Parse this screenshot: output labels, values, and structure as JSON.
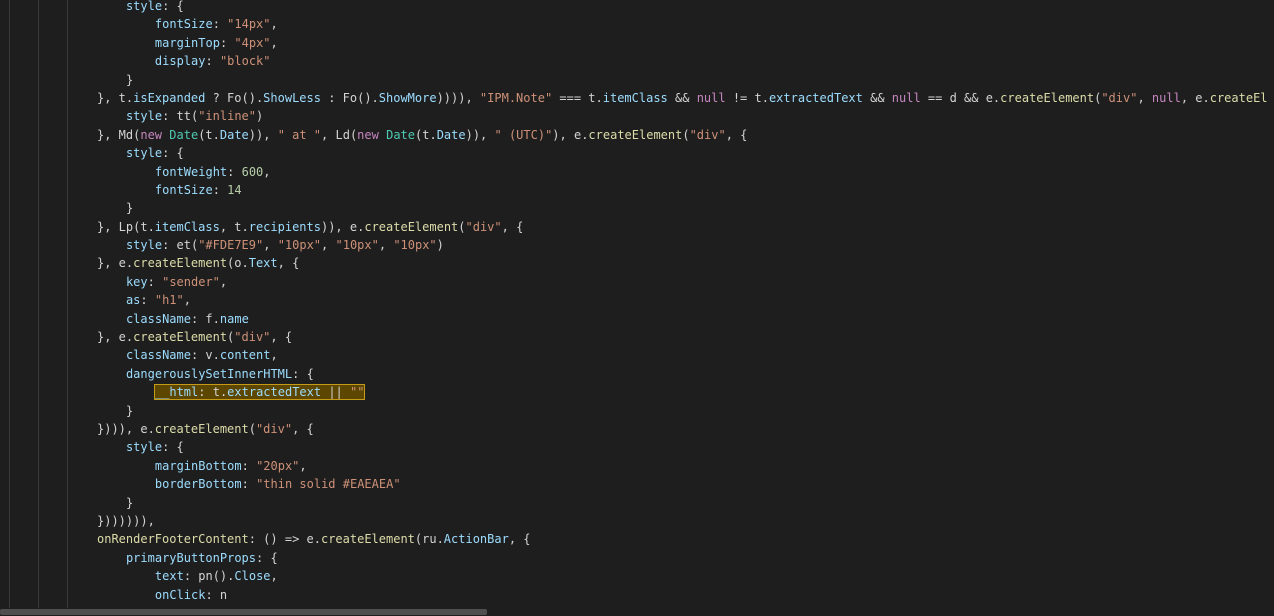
{
  "editor": {
    "lines": [
      {
        "indent": 4,
        "tokens": [
          [
            "prop",
            "style"
          ],
          [
            "p",
            ": {"
          ]
        ]
      },
      {
        "indent": 8,
        "tokens": [
          [
            "prop",
            "fontSize"
          ],
          [
            "p",
            ": "
          ],
          [
            "str",
            "\"14px\""
          ],
          [
            "p",
            ","
          ]
        ]
      },
      {
        "indent": 8,
        "tokens": [
          [
            "prop",
            "marginTop"
          ],
          [
            "p",
            ": "
          ],
          [
            "str",
            "\"4px\""
          ],
          [
            "p",
            ","
          ]
        ]
      },
      {
        "indent": 8,
        "tokens": [
          [
            "prop",
            "display"
          ],
          [
            "p",
            ": "
          ],
          [
            "str",
            "\"block\""
          ]
        ]
      },
      {
        "indent": 4,
        "tokens": [
          [
            "p",
            "}"
          ]
        ]
      },
      {
        "indent": 0,
        "tokens": [
          [
            "p",
            "}, t."
          ],
          [
            "prop",
            "isExpanded"
          ],
          [
            "p",
            " ? Fo()."
          ],
          [
            "prop",
            "ShowLess"
          ],
          [
            "p",
            " : Fo()."
          ],
          [
            "prop",
            "ShowMore"
          ],
          [
            "p",
            ")))), "
          ],
          [
            "str",
            "\"IPM.Note\""
          ],
          [
            "p",
            " === t."
          ],
          [
            "prop",
            "itemClass"
          ],
          [
            "p",
            " && "
          ],
          [
            "kw",
            "null"
          ],
          [
            "p",
            " != t."
          ],
          [
            "prop",
            "extractedText"
          ],
          [
            "p",
            " && "
          ],
          [
            "kw",
            "null"
          ],
          [
            "p",
            " == d && e."
          ],
          [
            "fn",
            "createElement"
          ],
          [
            "p",
            "("
          ],
          [
            "str",
            "\"div\""
          ],
          [
            "p",
            ", "
          ],
          [
            "kw",
            "null"
          ],
          [
            "p",
            ", e."
          ],
          [
            "fn",
            "createEl"
          ]
        ]
      },
      {
        "indent": 4,
        "tokens": [
          [
            "prop",
            "style"
          ],
          [
            "p",
            ": tt("
          ],
          [
            "str",
            "\"inline\""
          ],
          [
            "p",
            ")"
          ]
        ]
      },
      {
        "indent": 0,
        "tokens": [
          [
            "p",
            "}, Md("
          ],
          [
            "kw",
            "new"
          ],
          [
            "p",
            " "
          ],
          [
            "cls",
            "Date"
          ],
          [
            "p",
            "(t."
          ],
          [
            "prop",
            "Date"
          ],
          [
            "p",
            ")), "
          ],
          [
            "str",
            "\" at \""
          ],
          [
            "p",
            ", Ld("
          ],
          [
            "kw",
            "new"
          ],
          [
            "p",
            " "
          ],
          [
            "cls",
            "Date"
          ],
          [
            "p",
            "(t."
          ],
          [
            "prop",
            "Date"
          ],
          [
            "p",
            ")), "
          ],
          [
            "str",
            "\" (UTC)\""
          ],
          [
            "p",
            "), e."
          ],
          [
            "fn",
            "createElement"
          ],
          [
            "p",
            "("
          ],
          [
            "str",
            "\"div\""
          ],
          [
            "p",
            ", {"
          ]
        ]
      },
      {
        "indent": 4,
        "tokens": [
          [
            "prop",
            "style"
          ],
          [
            "p",
            ": {"
          ]
        ]
      },
      {
        "indent": 8,
        "tokens": [
          [
            "prop",
            "fontWeight"
          ],
          [
            "p",
            ": "
          ],
          [
            "num",
            "600"
          ],
          [
            "p",
            ","
          ]
        ]
      },
      {
        "indent": 8,
        "tokens": [
          [
            "prop",
            "fontSize"
          ],
          [
            "p",
            ": "
          ],
          [
            "num",
            "14"
          ]
        ]
      },
      {
        "indent": 4,
        "tokens": [
          [
            "p",
            "}"
          ]
        ]
      },
      {
        "indent": 0,
        "tokens": [
          [
            "p",
            "}, Lp(t."
          ],
          [
            "prop",
            "itemClass"
          ],
          [
            "p",
            ", t."
          ],
          [
            "prop",
            "recipients"
          ],
          [
            "p",
            ")), e."
          ],
          [
            "fn",
            "createElement"
          ],
          [
            "p",
            "("
          ],
          [
            "str",
            "\"div\""
          ],
          [
            "p",
            ", {"
          ]
        ]
      },
      {
        "indent": 4,
        "tokens": [
          [
            "prop",
            "style"
          ],
          [
            "p",
            ": et("
          ],
          [
            "str",
            "\"#FDE7E9\""
          ],
          [
            "p",
            ", "
          ],
          [
            "str",
            "\"10px\""
          ],
          [
            "p",
            ", "
          ],
          [
            "str",
            "\"10px\""
          ],
          [
            "p",
            ", "
          ],
          [
            "str",
            "\"10px\""
          ],
          [
            "p",
            ")"
          ]
        ]
      },
      {
        "indent": 0,
        "tokens": [
          [
            "p",
            "}, e."
          ],
          [
            "fn",
            "createElement"
          ],
          [
            "p",
            "(o."
          ],
          [
            "prop",
            "Text"
          ],
          [
            "p",
            ", {"
          ]
        ]
      },
      {
        "indent": 4,
        "tokens": [
          [
            "prop",
            "key"
          ],
          [
            "p",
            ": "
          ],
          [
            "str",
            "\"sender\""
          ],
          [
            "p",
            ","
          ]
        ]
      },
      {
        "indent": 4,
        "tokens": [
          [
            "prop",
            "as"
          ],
          [
            "p",
            ": "
          ],
          [
            "str",
            "\"h1\""
          ],
          [
            "p",
            ","
          ]
        ]
      },
      {
        "indent": 4,
        "tokens": [
          [
            "prop",
            "className"
          ],
          [
            "p",
            ": f."
          ],
          [
            "prop",
            "name"
          ]
        ]
      },
      {
        "indent": 0,
        "tokens": [
          [
            "p",
            "}, e."
          ],
          [
            "fn",
            "createElement"
          ],
          [
            "p",
            "("
          ],
          [
            "str",
            "\"div\""
          ],
          [
            "p",
            ", {"
          ]
        ]
      },
      {
        "indent": 4,
        "tokens": [
          [
            "prop",
            "className"
          ],
          [
            "p",
            ": v."
          ],
          [
            "prop",
            "content"
          ],
          [
            "p",
            ","
          ]
        ]
      },
      {
        "indent": 4,
        "tokens": [
          [
            "prop",
            "dangerouslySetInnerHTML"
          ],
          [
            "p",
            ": {"
          ]
        ]
      },
      {
        "indent": 8,
        "highlight": true,
        "tokens": [
          [
            "prop",
            "__html"
          ],
          [
            "p",
            ": t."
          ],
          [
            "prop",
            "extractedText"
          ],
          [
            "p",
            " || "
          ],
          [
            "str",
            "\"\""
          ]
        ]
      },
      {
        "indent": 4,
        "tokens": [
          [
            "p",
            "}"
          ]
        ]
      },
      {
        "indent": 0,
        "tokens": [
          [
            "p",
            "}))), e."
          ],
          [
            "fn",
            "createElement"
          ],
          [
            "p",
            "("
          ],
          [
            "str",
            "\"div\""
          ],
          [
            "p",
            ", {"
          ]
        ]
      },
      {
        "indent": 4,
        "tokens": [
          [
            "prop",
            "style"
          ],
          [
            "p",
            ": {"
          ]
        ]
      },
      {
        "indent": 8,
        "tokens": [
          [
            "prop",
            "marginBottom"
          ],
          [
            "p",
            ": "
          ],
          [
            "str",
            "\"20px\""
          ],
          [
            "p",
            ","
          ]
        ]
      },
      {
        "indent": 8,
        "tokens": [
          [
            "prop",
            "borderBottom"
          ],
          [
            "p",
            ": "
          ],
          [
            "str",
            "\"thin solid #EAEAEA\""
          ]
        ]
      },
      {
        "indent": 4,
        "tokens": [
          [
            "p",
            "}"
          ]
        ]
      },
      {
        "indent": 0,
        "tokens": [
          [
            "p",
            "})))))),"
          ]
        ]
      },
      {
        "indent": 0,
        "tokens": [
          [
            "fn",
            "onRenderFooterContent"
          ],
          [
            "p",
            ": () => e."
          ],
          [
            "fn",
            "createElement"
          ],
          [
            "p",
            "(ru."
          ],
          [
            "prop",
            "ActionBar"
          ],
          [
            "p",
            ", {"
          ]
        ]
      },
      {
        "indent": 4,
        "tokens": [
          [
            "prop",
            "primaryButtonProps"
          ],
          [
            "p",
            ": {"
          ]
        ]
      },
      {
        "indent": 8,
        "tokens": [
          [
            "prop",
            "text"
          ],
          [
            "p",
            ": pn()."
          ],
          [
            "prop",
            "Close"
          ],
          [
            "p",
            ","
          ]
        ]
      },
      {
        "indent": 8,
        "tokens": [
          [
            "prop",
            "onClick"
          ],
          [
            "p",
            ": n"
          ]
        ]
      }
    ]
  },
  "colors": {
    "background": "#1e1e1e",
    "highlight_bg": "#5c4600",
    "highlight_border": "#c59a16"
  },
  "scrollbar": {
    "horizontal_position_fraction": 0.38
  }
}
